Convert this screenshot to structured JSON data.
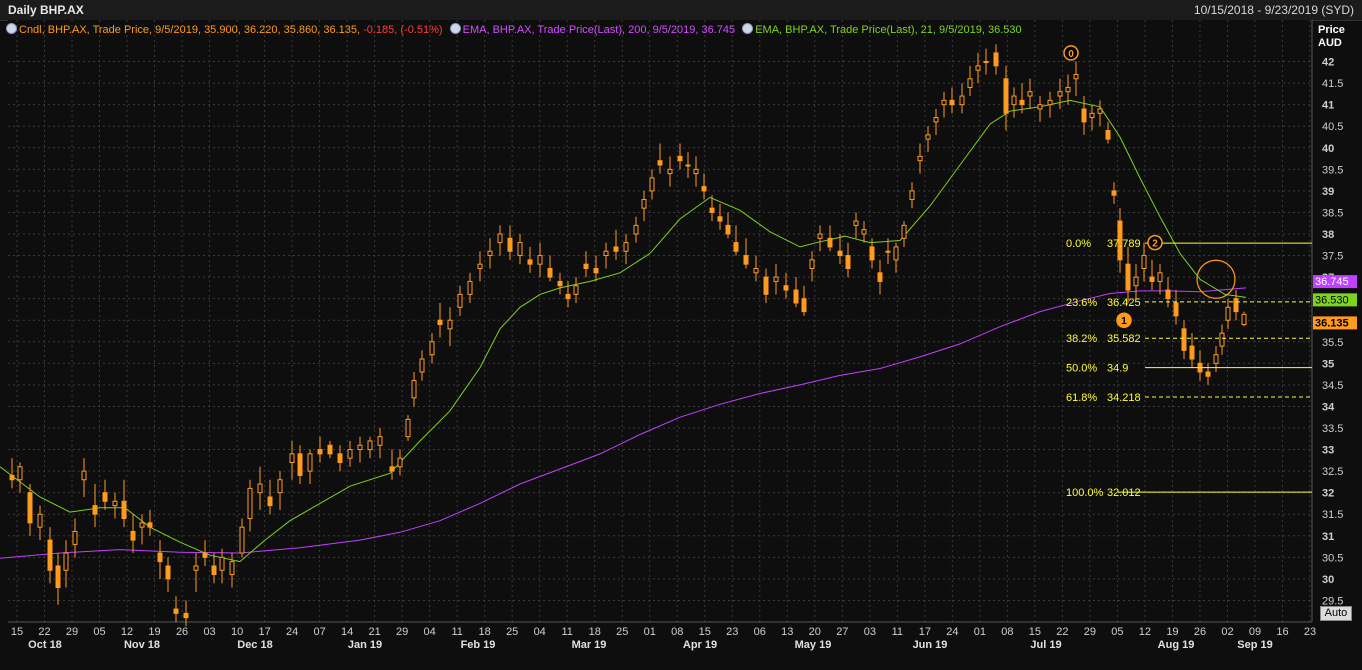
{
  "header": {
    "title": "Daily BHP.AX",
    "date_range": "10/15/2018 - 9/23/2019 (SYD)"
  },
  "legend": [
    {
      "text": "Cndl, BHP.AX, Trade Price, 9/5/2019, 35.900, 36.220, 35.860, 36.135, ",
      "text2": "-0.185, (-0.51%)",
      "color": "#ff9a1e",
      "color2": "#ff3b3b"
    },
    {
      "text": "EMA, BHP.AX, Trade Price(Last),  200, 9/5/2019, 36.745",
      "color": "#d24dff"
    },
    {
      "text": "EMA, BHP.AX, Trade Price(Last),  21, 9/5/2019, 36.530",
      "color": "#7ed321"
    }
  ],
  "axis": {
    "price_label_1": "Price",
    "price_label_2": "AUD",
    "auto_button": "Auto"
  },
  "colors": {
    "background": "#0e0e0e",
    "candle": "#ff9a1e",
    "ema200": "#c040ff",
    "ema21": "#7ed321",
    "fib": "#ffff33",
    "grid": "#3a3a3a"
  },
  "chart_data": {
    "type": "candlestick",
    "title": "Daily BHP.AX",
    "yaxis": {
      "label": "Price AUD",
      "range": [
        29.0,
        42.5
      ],
      "ticks": [
        29.5,
        30,
        30.5,
        31,
        31.5,
        32,
        32.5,
        33,
        33.5,
        34,
        34.5,
        35,
        35.5,
        36,
        36.5,
        37,
        37.5,
        38,
        38.5,
        39,
        39.5,
        40,
        40.5,
        41,
        41.5,
        42
      ]
    },
    "xaxis": {
      "day_ticks": [
        "15",
        "22",
        "29",
        "05",
        "12",
        "19",
        "26",
        "03",
        "10",
        "17",
        "24",
        "07",
        "14",
        "21",
        "29",
        "04",
        "11",
        "18",
        "25",
        "04",
        "11",
        "18",
        "25",
        "01",
        "08",
        "15",
        "23",
        "06",
        "13",
        "20",
        "27",
        "03",
        "11",
        "17",
        "24",
        "01",
        "08",
        "15",
        "22",
        "29",
        "05",
        "12",
        "19",
        "26",
        "02",
        "09",
        "16",
        "23"
      ],
      "month_labels": [
        "Oct 18",
        "Nov 18",
        "Dec 18",
        "Jan 19",
        "Feb 19",
        "Mar 19",
        "Apr 19",
        "May 19",
        "Jun 19",
        "Jul 19",
        "Aug 19",
        "Sep 19"
      ]
    },
    "grid": true,
    "series": [
      {
        "name": "EMA 200",
        "points": [
          [
            0,
            30.48
          ],
          [
            60,
            30.6
          ],
          [
            120,
            30.68
          ],
          [
            180,
            30.62
          ],
          [
            240,
            30.6
          ],
          [
            300,
            30.72
          ],
          [
            360,
            30.9
          ],
          [
            400,
            31.08
          ],
          [
            440,
            31.35
          ],
          [
            480,
            31.75
          ],
          [
            520,
            32.2
          ],
          [
            560,
            32.55
          ],
          [
            600,
            32.9
          ],
          [
            640,
            33.35
          ],
          [
            680,
            33.75
          ],
          [
            720,
            34.05
          ],
          [
            760,
            34.3
          ],
          [
            800,
            34.5
          ],
          [
            840,
            34.72
          ],
          [
            880,
            34.88
          ],
          [
            920,
            35.15
          ],
          [
            960,
            35.45
          ],
          [
            1000,
            35.85
          ],
          [
            1040,
            36.2
          ],
          [
            1080,
            36.45
          ],
          [
            1110,
            36.62
          ],
          [
            1140,
            36.68
          ],
          [
            1170,
            36.68
          ],
          [
            1200,
            36.66
          ],
          [
            1246,
            36.75
          ]
        ]
      },
      {
        "name": "EMA 21",
        "points": [
          [
            0,
            32.6
          ],
          [
            40,
            31.9
          ],
          [
            70,
            31.55
          ],
          [
            100,
            31.65
          ],
          [
            125,
            31.65
          ],
          [
            150,
            31.2
          ],
          [
            180,
            30.85
          ],
          [
            210,
            30.55
          ],
          [
            240,
            30.4
          ],
          [
            265,
            30.9
          ],
          [
            290,
            31.35
          ],
          [
            320,
            31.75
          ],
          [
            350,
            32.15
          ],
          [
            390,
            32.45
          ],
          [
            420,
            33.2
          ],
          [
            450,
            33.9
          ],
          [
            480,
            34.9
          ],
          [
            500,
            35.8
          ],
          [
            520,
            36.3
          ],
          [
            540,
            36.6
          ],
          [
            560,
            36.75
          ],
          [
            590,
            36.9
          ],
          [
            620,
            37.1
          ],
          [
            650,
            37.55
          ],
          [
            680,
            38.35
          ],
          [
            710,
            38.85
          ],
          [
            740,
            38.55
          ],
          [
            770,
            38.05
          ],
          [
            800,
            37.7
          ],
          [
            820,
            37.82
          ],
          [
            845,
            37.95
          ],
          [
            870,
            37.8
          ],
          [
            900,
            37.85
          ],
          [
            930,
            38.65
          ],
          [
            960,
            39.6
          ],
          [
            990,
            40.55
          ],
          [
            1010,
            40.85
          ],
          [
            1040,
            40.95
          ],
          [
            1070,
            41.1
          ],
          [
            1100,
            40.95
          ],
          [
            1120,
            40.25
          ],
          [
            1140,
            39.3
          ],
          [
            1160,
            38.4
          ],
          [
            1180,
            37.55
          ],
          [
            1200,
            36.95
          ],
          [
            1225,
            36.6
          ],
          [
            1246,
            36.53
          ]
        ]
      }
    ],
    "ohlc_points": [
      [
        12,
        32.4,
        32.8,
        32.1,
        32.3
      ],
      [
        20,
        32.3,
        32.7,
        32.0,
        32.6
      ],
      [
        30,
        32.0,
        32.2,
        31.0,
        31.3
      ],
      [
        40,
        31.2,
        31.7,
        30.9,
        31.5
      ],
      [
        50,
        30.9,
        31.2,
        29.9,
        30.2
      ],
      [
        58,
        30.3,
        30.6,
        29.4,
        29.8
      ],
      [
        66,
        30.2,
        30.9,
        29.8,
        30.6
      ],
      [
        75,
        30.8,
        31.4,
        30.5,
        31.1
      ],
      [
        84,
        32.3,
        32.8,
        31.9,
        32.5
      ],
      [
        95,
        31.7,
        32.2,
        31.2,
        31.5
      ],
      [
        105,
        32.0,
        32.3,
        31.6,
        31.8
      ],
      [
        115,
        31.7,
        32.0,
        31.4,
        31.8
      ],
      [
        124,
        31.8,
        32.3,
        31.2,
        31.4
      ],
      [
        133,
        31.1,
        31.5,
        30.6,
        30.9
      ],
      [
        142,
        31.2,
        31.5,
        30.8,
        31.3
      ],
      [
        150,
        31.3,
        31.6,
        31.0,
        31.2
      ],
      [
        160,
        30.6,
        30.9,
        30.0,
        30.4
      ],
      [
        168,
        30.3,
        30.5,
        29.7,
        30.0
      ],
      [
        176,
        29.3,
        29.6,
        29.0,
        29.2
      ],
      [
        186,
        29.2,
        29.5,
        28.9,
        29.1
      ],
      [
        196,
        30.2,
        30.6,
        29.7,
        30.3
      ],
      [
        205,
        30.6,
        30.9,
        30.3,
        30.5
      ],
      [
        214,
        30.3,
        30.6,
        29.9,
        30.1
      ],
      [
        222,
        30.2,
        30.7,
        29.9,
        30.5
      ],
      [
        232,
        30.1,
        30.6,
        29.8,
        30.4
      ],
      [
        242,
        30.6,
        31.4,
        30.5,
        31.2
      ],
      [
        250,
        31.4,
        32.3,
        31.1,
        32.1
      ],
      [
        260,
        32.0,
        32.6,
        31.6,
        32.2
      ],
      [
        270,
        31.9,
        32.3,
        31.5,
        31.7
      ],
      [
        280,
        32.0,
        32.5,
        31.6,
        32.3
      ],
      [
        292,
        32.7,
        33.2,
        32.3,
        32.9
      ],
      [
        300,
        32.9,
        33.1,
        32.2,
        32.4
      ],
      [
        310,
        32.5,
        33.0,
        32.2,
        32.9
      ],
      [
        320,
        33.0,
        33.3,
        32.7,
        32.9
      ],
      [
        330,
        33.1,
        33.2,
        32.8,
        32.9
      ],
      [
        340,
        32.9,
        33.1,
        32.5,
        32.7
      ],
      [
        350,
        32.8,
        33.2,
        32.6,
        33.0
      ],
      [
        360,
        33.0,
        33.3,
        32.7,
        33.1
      ],
      [
        370,
        33.0,
        33.3,
        32.8,
        33.2
      ],
      [
        380,
        33.1,
        33.5,
        32.8,
        33.3
      ],
      [
        392,
        32.6,
        33.0,
        32.3,
        32.5
      ],
      [
        400,
        32.6,
        33.0,
        32.4,
        32.8
      ],
      [
        408,
        33.3,
        33.8,
        33.2,
        33.7
      ],
      [
        414,
        34.2,
        34.8,
        34.0,
        34.6
      ],
      [
        422,
        34.8,
        35.3,
        34.6,
        35.1
      ],
      [
        432,
        35.2,
        35.7,
        35.0,
        35.5
      ],
      [
        440,
        36.0,
        36.4,
        35.6,
        35.9
      ],
      [
        450,
        35.8,
        36.3,
        35.4,
        36.0
      ],
      [
        460,
        36.3,
        36.8,
        36.1,
        36.6
      ],
      [
        470,
        36.6,
        37.1,
        36.4,
        36.9
      ],
      [
        480,
        37.2,
        37.6,
        36.9,
        37.3
      ],
      [
        490,
        37.5,
        37.9,
        37.2,
        37.6
      ],
      [
        500,
        37.8,
        38.2,
        37.5,
        38.0
      ],
      [
        510,
        37.9,
        38.2,
        37.4,
        37.6
      ],
      [
        520,
        37.5,
        38.0,
        37.3,
        37.8
      ],
      [
        530,
        37.4,
        37.7,
        37.1,
        37.3
      ],
      [
        540,
        37.3,
        37.8,
        37.0,
        37.5
      ],
      [
        550,
        37.2,
        37.5,
        36.9,
        37.0
      ],
      [
        560,
        36.9,
        37.1,
        36.6,
        36.8
      ],
      [
        568,
        36.6,
        36.9,
        36.3,
        36.5
      ],
      [
        576,
        36.6,
        37.0,
        36.4,
        36.8
      ],
      [
        586,
        37.3,
        37.6,
        37.0,
        37.2
      ],
      [
        596,
        37.2,
        37.5,
        36.9,
        37.1
      ],
      [
        606,
        37.5,
        37.8,
        37.2,
        37.6
      ],
      [
        616,
        37.7,
        38.1,
        37.4,
        37.6
      ],
      [
        626,
        37.6,
        38.0,
        37.3,
        37.8
      ],
      [
        636,
        38.0,
        38.4,
        37.8,
        38.2
      ],
      [
        644,
        38.6,
        39.0,
        38.3,
        38.8
      ],
      [
        652,
        39.0,
        39.5,
        38.8,
        39.3
      ],
      [
        660,
        39.7,
        40.1,
        39.4,
        39.6
      ],
      [
        670,
        39.4,
        39.8,
        39.1,
        39.5
      ],
      [
        680,
        39.8,
        40.1,
        39.5,
        39.7
      ],
      [
        688,
        39.6,
        39.9,
        39.3,
        39.6
      ],
      [
        696,
        39.4,
        39.8,
        39.1,
        39.5
      ],
      [
        704,
        39.1,
        39.4,
        38.8,
        39.0
      ],
      [
        712,
        38.6,
        38.9,
        38.3,
        38.5
      ],
      [
        720,
        38.4,
        38.7,
        38.1,
        38.3
      ],
      [
        728,
        38.2,
        38.5,
        37.9,
        38.0
      ],
      [
        736,
        37.8,
        38.2,
        37.5,
        37.6
      ],
      [
        746,
        37.5,
        37.9,
        37.2,
        37.3
      ],
      [
        756,
        37.1,
        37.5,
        36.9,
        37.2
      ],
      [
        766,
        37.0,
        37.2,
        36.4,
        36.6
      ],
      [
        776,
        36.9,
        37.3,
        36.6,
        37.0
      ],
      [
        786,
        36.8,
        37.1,
        36.5,
        36.7
      ],
      [
        796,
        36.7,
        37.0,
        36.3,
        36.4
      ],
      [
        804,
        36.5,
        36.8,
        36.1,
        36.2
      ],
      [
        812,
        37.2,
        37.6,
        36.9,
        37.4
      ],
      [
        820,
        37.9,
        38.2,
        37.6,
        38.0
      ],
      [
        830,
        37.9,
        38.2,
        37.6,
        37.7
      ],
      [
        840,
        37.6,
        38.0,
        37.3,
        37.5
      ],
      [
        848,
        37.5,
        37.8,
        37.0,
        37.2
      ],
      [
        856,
        38.2,
        38.5,
        37.9,
        38.3
      ],
      [
        864,
        38.0,
        38.3,
        37.8,
        38.1
      ],
      [
        872,
        37.7,
        37.9,
        37.2,
        37.4
      ],
      [
        880,
        37.1,
        37.4,
        36.6,
        36.9
      ],
      [
        888,
        37.6,
        37.9,
        37.3,
        37.6
      ],
      [
        896,
        37.4,
        37.8,
        37.1,
        37.7
      ],
      [
        904,
        37.9,
        38.3,
        37.7,
        38.2
      ],
      [
        912,
        38.8,
        39.2,
        38.6,
        39.0
      ],
      [
        920,
        39.7,
        40.1,
        39.4,
        39.8
      ],
      [
        928,
        40.2,
        40.5,
        39.9,
        40.3
      ],
      [
        936,
        40.6,
        40.9,
        40.3,
        40.7
      ],
      [
        944,
        41.0,
        41.3,
        40.7,
        41.1
      ],
      [
        952,
        41.1,
        41.4,
        40.8,
        41.0
      ],
      [
        962,
        41.0,
        41.5,
        40.8,
        41.2
      ],
      [
        970,
        41.4,
        41.9,
        41.2,
        41.6
      ],
      [
        978,
        41.8,
        42.2,
        41.5,
        41.9
      ],
      [
        986,
        42.0,
        42.3,
        41.7,
        42.0
      ],
      [
        996,
        42.2,
        42.4,
        41.7,
        41.9
      ],
      [
        1006,
        41.6,
        41.9,
        40.4,
        40.8
      ],
      [
        1014,
        41.0,
        41.4,
        40.7,
        41.2
      ],
      [
        1022,
        41.1,
        41.5,
        40.8,
        41.0
      ],
      [
        1030,
        41.2,
        41.6,
        40.9,
        41.3
      ],
      [
        1040,
        40.9,
        41.2,
        40.6,
        41.0
      ],
      [
        1050,
        41.0,
        41.3,
        40.7,
        41.1
      ],
      [
        1060,
        41.2,
        41.6,
        40.9,
        41.3
      ],
      [
        1068,
        41.3,
        41.7,
        41.0,
        41.4
      ],
      [
        1076,
        41.6,
        42.0,
        41.2,
        41.7
      ],
      [
        1084,
        40.9,
        41.2,
        40.3,
        40.6
      ],
      [
        1092,
        40.7,
        41.0,
        40.4,
        40.8
      ],
      [
        1100,
        40.8,
        41.1,
        40.5,
        40.9
      ],
      [
        1108,
        40.4,
        40.6,
        40.1,
        40.2
      ],
      [
        1114,
        39.0,
        39.2,
        38.7,
        38.9
      ],
      [
        1120,
        38.3,
        38.6,
        37.1,
        37.4
      ],
      [
        1128,
        37.3,
        37.7,
        36.4,
        36.7
      ],
      [
        1136,
        36.8,
        37.3,
        36.5,
        37.0
      ],
      [
        1144,
        37.2,
        37.8,
        36.9,
        37.5
      ],
      [
        1152,
        37.0,
        37.4,
        36.7,
        36.9
      ],
      [
        1160,
        36.9,
        37.3,
        36.6,
        37.1
      ],
      [
        1168,
        36.7,
        37.0,
        36.3,
        36.5
      ],
      [
        1176,
        36.4,
        36.7,
        35.9,
        36.1
      ],
      [
        1184,
        35.8,
        36.0,
        35.1,
        35.3
      ],
      [
        1192,
        35.4,
        35.7,
        34.9,
        35.1
      ],
      [
        1200,
        35.0,
        35.3,
        34.6,
        34.8
      ],
      [
        1208,
        34.8,
        35.0,
        34.5,
        34.7
      ],
      [
        1216,
        35.0,
        35.4,
        34.8,
        35.2
      ],
      [
        1222,
        35.4,
        35.9,
        35.2,
        35.7
      ],
      [
        1228,
        36.0,
        36.5,
        35.8,
        36.3
      ],
      [
        1236,
        36.5,
        36.7,
        36.0,
        36.2
      ],
      [
        1244,
        35.9,
        36.2,
        35.86,
        36.135
      ]
    ],
    "fibonacci": [
      {
        "level": "0.0%",
        "price": "37.789"
      },
      {
        "level": "23.6%",
        "price": "36.425"
      },
      {
        "level": "38.2%",
        "price": "35.582"
      },
      {
        "level": "50.0%",
        "price": "34.9"
      },
      {
        "level": "61.8%",
        "price": "34.218"
      },
      {
        "level": "100.0%",
        "price": "32.012"
      }
    ],
    "markers": [
      {
        "label": "0",
        "x": 1071,
        "price": 42.2
      },
      {
        "label": "1",
        "x": 1124,
        "price": 36.0
      },
      {
        "label": "2",
        "x": 1155,
        "price": 37.8
      }
    ],
    "price_tags": [
      {
        "value": "36.745",
        "color": "#c040ff"
      },
      {
        "value": "36.530",
        "color": "#7ed321"
      },
      {
        "value": "36.135",
        "color": "#ff9a1e"
      }
    ]
  }
}
